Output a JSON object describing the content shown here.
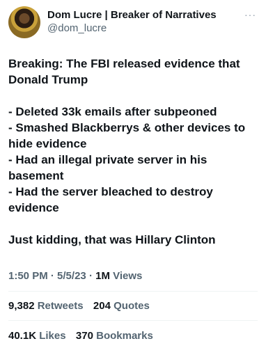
{
  "author": {
    "display_name": "Dom Lucre | Breaker of Narratives",
    "handle": "@dom_lucre"
  },
  "more_glyph": "···",
  "tweet_lines": [
    "Breaking: The FBI released evidence that",
    "Donald Trump",
    "",
    "- Deleted 33k emails after subpeoned",
    "- Smashed Blackberrys & other devices to",
    "hide evidence",
    "- Had an illegal private server in his",
    "basement",
    "- Had the server bleached to destroy",
    "evidence",
    "",
    "Just kidding, that was Hillary Clinton"
  ],
  "meta": {
    "time": "1:50 PM",
    "date": "5/5/23",
    "views_count": "1M",
    "views_label": "Views"
  },
  "stats": {
    "retweets_count": "9,382",
    "retweets_label": "Retweets",
    "quotes_count": "204",
    "quotes_label": "Quotes",
    "likes_count": "40.1K",
    "likes_label": "Likes",
    "bookmarks_count": "370",
    "bookmarks_label": "Bookmarks"
  }
}
